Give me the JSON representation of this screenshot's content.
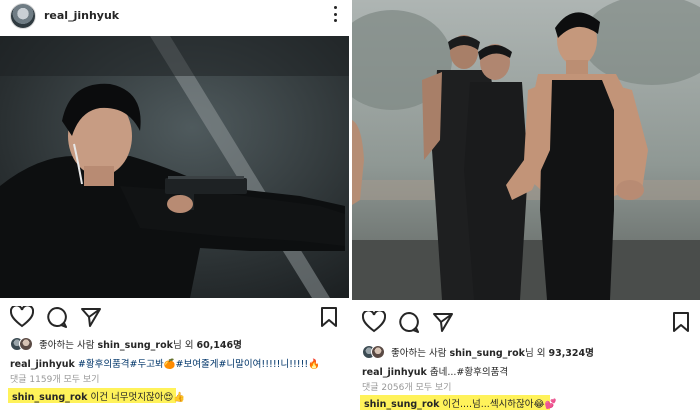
{
  "colors": {
    "highlight": "#fff25a",
    "hashtag": "#003569",
    "muted": "#999999",
    "text": "#262626"
  },
  "left_post": {
    "username": "real_jinhyuk",
    "likes_prefix": "좋아하는 사람 ",
    "likes_user": "shin_sung_rok",
    "likes_mid": "님 외 ",
    "likes_count": "60,146명",
    "caption_user": "real_jinhyuk",
    "caption_text": "#황후의품격#두고봐🍊#보여줄게#니말이여!!!!!니!!!!!🔥",
    "view_comments": "댓글 1159개 모두 보기",
    "comment_user": "shin_sung_rok",
    "comment_text": " 이건 너무멋지잖아😍👍",
    "icons": [
      "heart-icon",
      "comment-icon",
      "share-icon",
      "bookmark-icon",
      "more-icon"
    ]
  },
  "right_post": {
    "likes_prefix": "좋아하는 사람 ",
    "likes_user": "shin_sung_rok",
    "likes_mid": "님 외 ",
    "likes_count": "93,324명",
    "caption_user": "real_jinhyuk",
    "caption_text": " 춥네...#황후의품격",
    "view_comments": "댓글 2056개 모두 보기",
    "comment_user": "shin_sung_rok",
    "comment_text": " 이건....넘...섹시하잖아😂💕",
    "icons": [
      "heart-icon",
      "comment-icon",
      "share-icon",
      "bookmark-icon"
    ]
  }
}
